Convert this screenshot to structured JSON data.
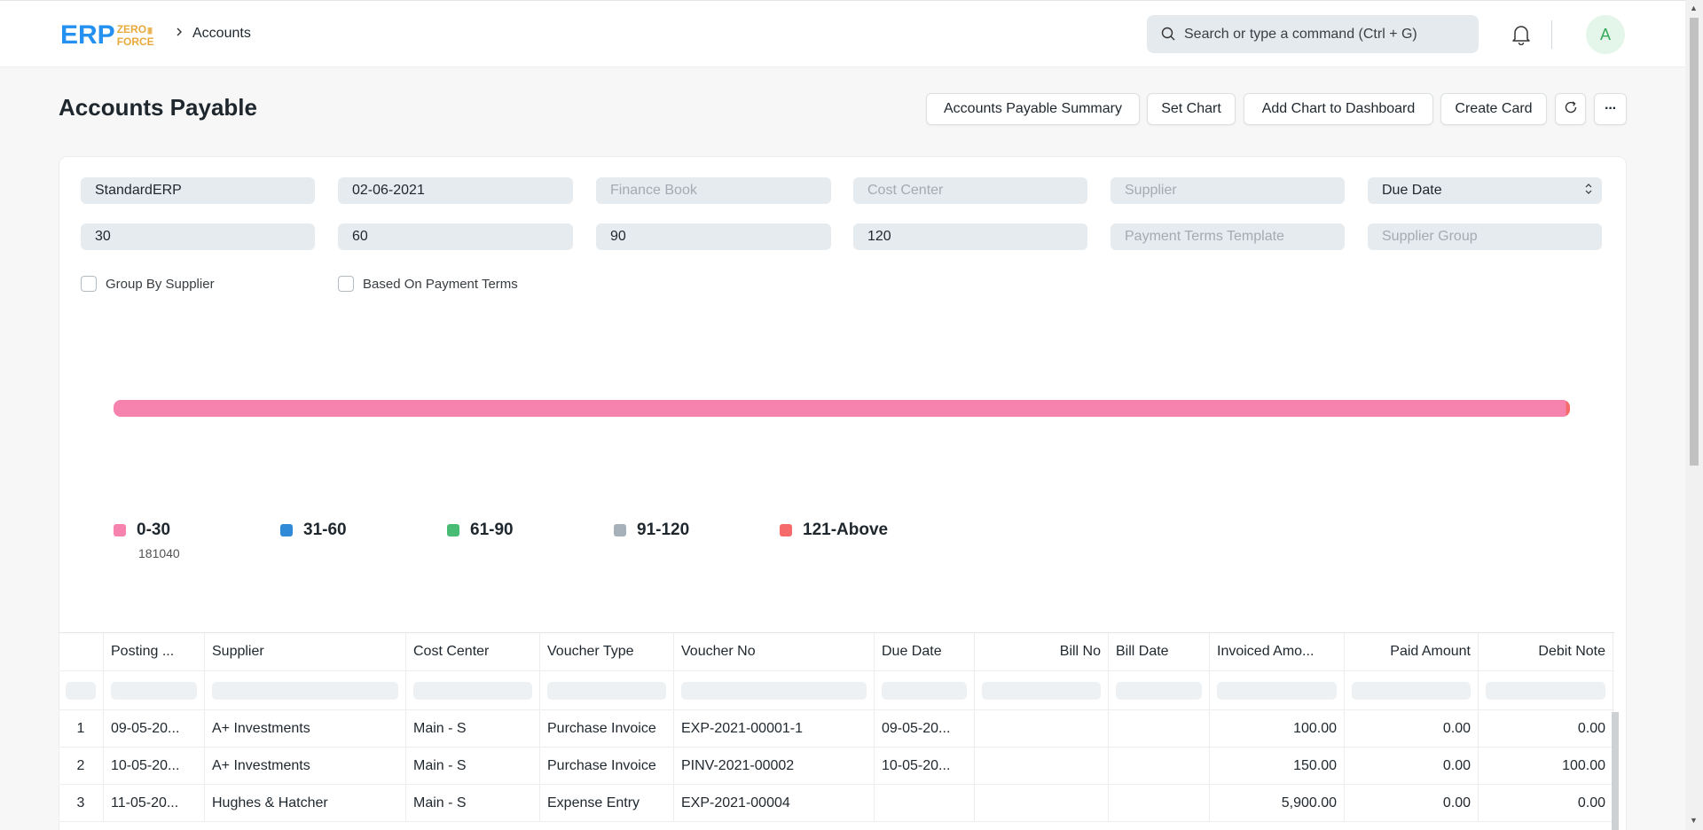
{
  "navbar": {
    "logo_main": "ERP",
    "logo_sub_top": "ZERO",
    "logo_sub_bottom": "FORCE",
    "breadcrumb_separator": ">",
    "breadcrumb": "Accounts",
    "search_placeholder": "Search or type a command (Ctrl + G)",
    "avatar_initial": "A"
  },
  "page": {
    "title": "Accounts Payable",
    "actions": {
      "summary": "Accounts Payable Summary",
      "set_chart": "Set Chart",
      "add_chart": "Add Chart to Dashboard",
      "create_card": "Create Card",
      "more": "···"
    }
  },
  "filters": {
    "company": "StandardERP",
    "report_date": "02-06-2021",
    "finance_book": "Finance Book",
    "cost_center": "Cost Center",
    "supplier": "Supplier",
    "ageing_based_on": "Due Date",
    "range1": "30",
    "range2": "60",
    "range3": "90",
    "range4": "120",
    "payment_terms_template": "Payment Terms Template",
    "supplier_group": "Supplier Group",
    "group_by_supplier": "Group By Supplier",
    "based_on_payment_terms": "Based On Payment Terms"
  },
  "colors": {
    "0-30": "#f683ae",
    "31-60": "#318ad8",
    "61-90": "#48bb74",
    "91-120": "#a6b1b9",
    "121-Above": "#f56b6b"
  },
  "chart_data": {
    "type": "bar",
    "stacked": true,
    "orientation": "horizontal",
    "categories": [
      "0-30",
      "31-60",
      "61-90",
      "91-120",
      "121-Above"
    ],
    "values": [
      181040,
      0,
      0,
      0,
      500
    ],
    "legend_value_label": "181040",
    "legend": "bottom"
  },
  "table": {
    "columns": [
      "",
      "Posting ...",
      "Supplier",
      "Cost Center",
      "Voucher Type",
      "Voucher No",
      "Due Date",
      "Bill No",
      "Bill Date",
      "Invoiced Amo...",
      "Paid Amount",
      "Debit Note"
    ],
    "rows": [
      [
        "1",
        "09-05-20...",
        "A+ Investments",
        "Main - S",
        "Purchase Invoice",
        "EXP-2021-00001-1",
        "09-05-20...",
        "",
        "",
        "100.00",
        "0.00",
        "0.00"
      ],
      [
        "2",
        "10-05-20...",
        "A+ Investments",
        "Main - S",
        "Purchase Invoice",
        "PINV-2021-00002",
        "10-05-20...",
        "",
        "",
        "150.00",
        "0.00",
        "100.00"
      ],
      [
        "3",
        "11-05-20...",
        "Hughes & Hatcher",
        "Main - S",
        "Expense Entry",
        "EXP-2021-00004",
        "",
        "",
        "",
        "5,900.00",
        "0.00",
        "0.00"
      ]
    ]
  }
}
